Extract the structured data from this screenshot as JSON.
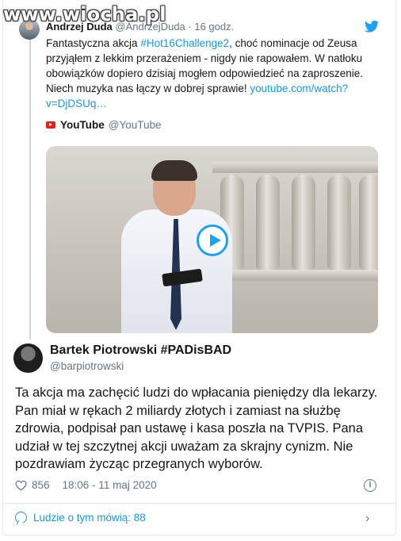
{
  "watermark": "www.wiocha.pl",
  "parent_tweet": {
    "name": "Andrzej Duda",
    "handle": "@AndrzejDuda",
    "time": "16 godz.",
    "text_start": "Fantastyczna akcja ",
    "hashtag": "#Hot16Challenge2",
    "text_rest": ", choć nominacje od Zeusa przyjąłem z lekkim przerażeniem - nigdy nie rapowałem. W natłoku obowiązków dopiero dzisiaj mogłem odpowiedzieć na zaproszenie. Niech muzyka nas łączy w dobrej sprawie! ",
    "link": "youtube.com/watch?v=DjDSUq…",
    "card_source_name": "YouTube",
    "card_source_handle": "@YouTube"
  },
  "main_tweet": {
    "name": "Bartek Piotrowski #PADisBAD",
    "handle": "@barpiotrowski",
    "text": "Ta akcja ma zachęcić ludzi do wpłacania pieniędzy dla lekarzy. Pan miał w rękach 2 miliardy złotych i zamiast na służbę zdrowia, podpisał pan ustawę i kasa poszła na TVPIS. Pana udział w tej szczytnej akcji uważam za skrajny cynizm. Nie pozdrawiam życząc przegranych wyborów.",
    "likes": "856",
    "timestamp": "18:06 - 11 maj 2020",
    "talking_label": "Ludzie o tym mówią: 88"
  },
  "icons": {
    "bird": "twitter-bird-icon",
    "heart": "heart-icon",
    "info": "info-icon",
    "talk": "chat-bubble-icon",
    "chevron": "chevron-right-icon",
    "play": "play-icon"
  },
  "colors": {
    "accent": "#1da1f2",
    "link": "#1b95e0",
    "muted": "#657786",
    "text": "#14171a",
    "youtube": "#e62117"
  }
}
